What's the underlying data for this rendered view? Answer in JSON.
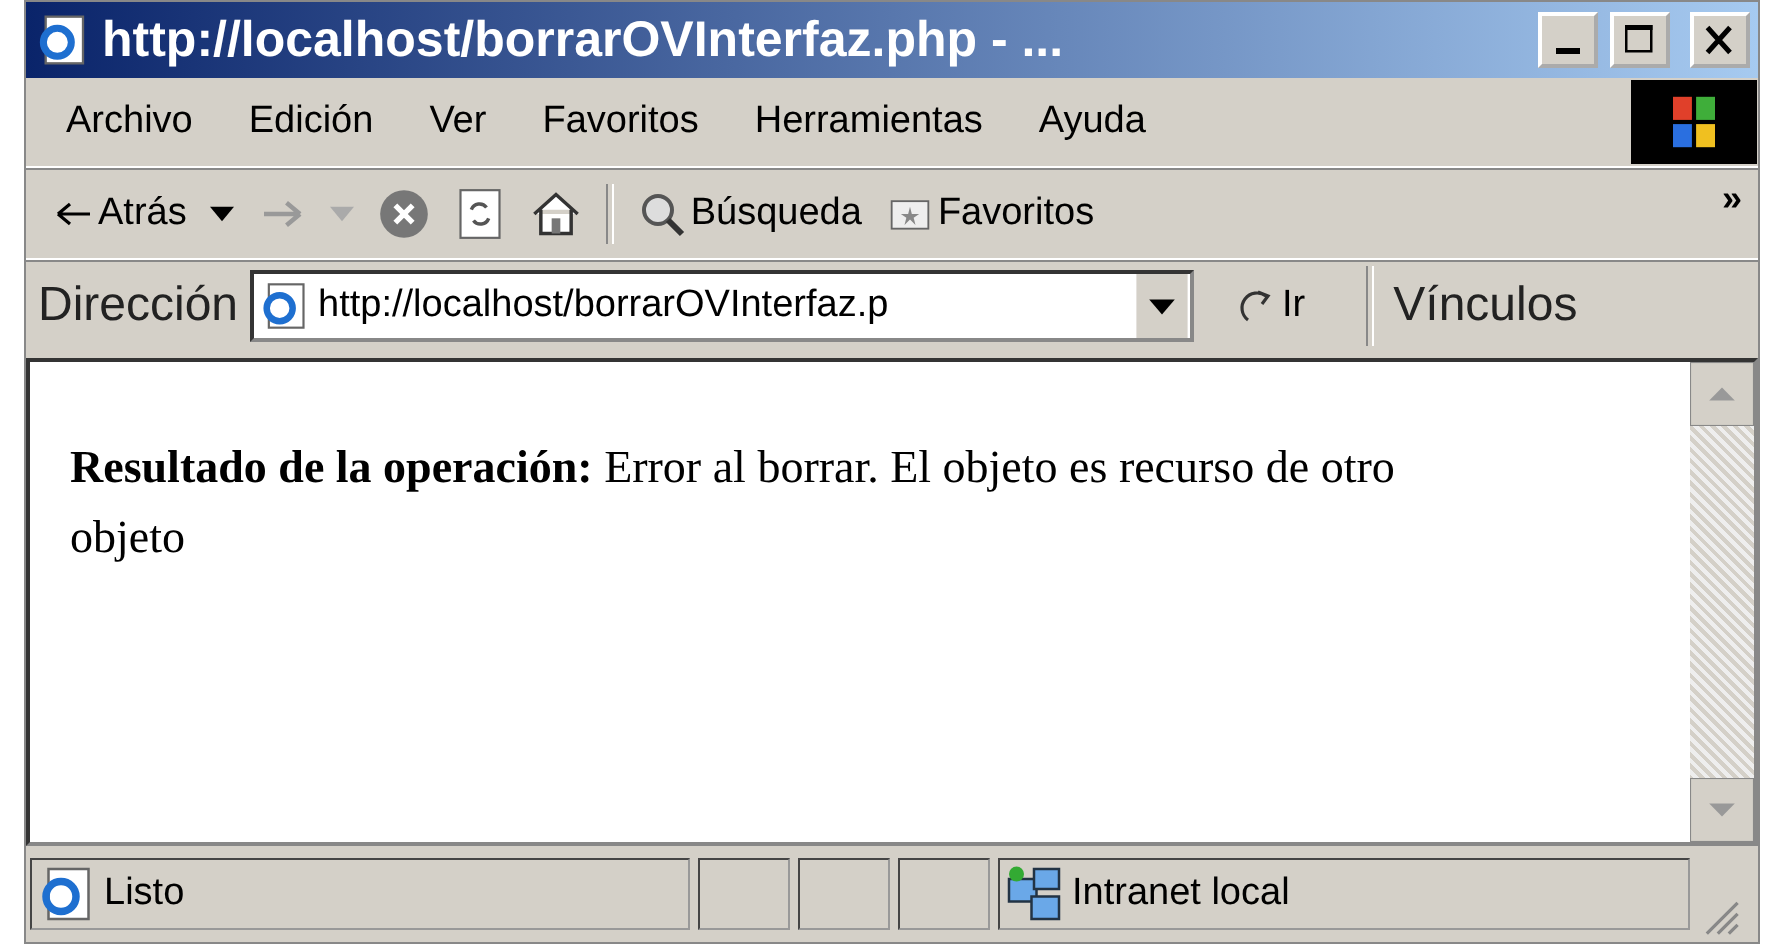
{
  "window": {
    "title": "http://localhost/borrarOVInterfaz.php - ..."
  },
  "menu": [
    {
      "label": "Archivo"
    },
    {
      "label": "Edición"
    },
    {
      "label": "Ver"
    },
    {
      "label": "Favoritos"
    },
    {
      "label": "Herramientas"
    },
    {
      "label": "Ayuda"
    }
  ],
  "toolbar": {
    "items": [
      {
        "kind": "back",
        "label": "Atrás"
      },
      {
        "kind": "forward"
      },
      {
        "kind": "stop"
      },
      {
        "kind": "refresh"
      },
      {
        "kind": "home"
      },
      {
        "kind": "separator"
      },
      {
        "kind": "search",
        "label": "Búsqueda"
      },
      {
        "kind": "favorites",
        "label": "Favoritos"
      }
    ],
    "overflow": "»"
  },
  "address": {
    "label": "Dirección",
    "value": "http://localhost/borrarOVInterfaz.p",
    "go": "Ir",
    "links": "Vínculos"
  },
  "content": {
    "text": "**Resultado de la operación:** Error al borrar. El objeto es recurso de otro objeto"
  },
  "status_bar": {
    "text": "Listo",
    "zone": "Intranet local"
  }
}
